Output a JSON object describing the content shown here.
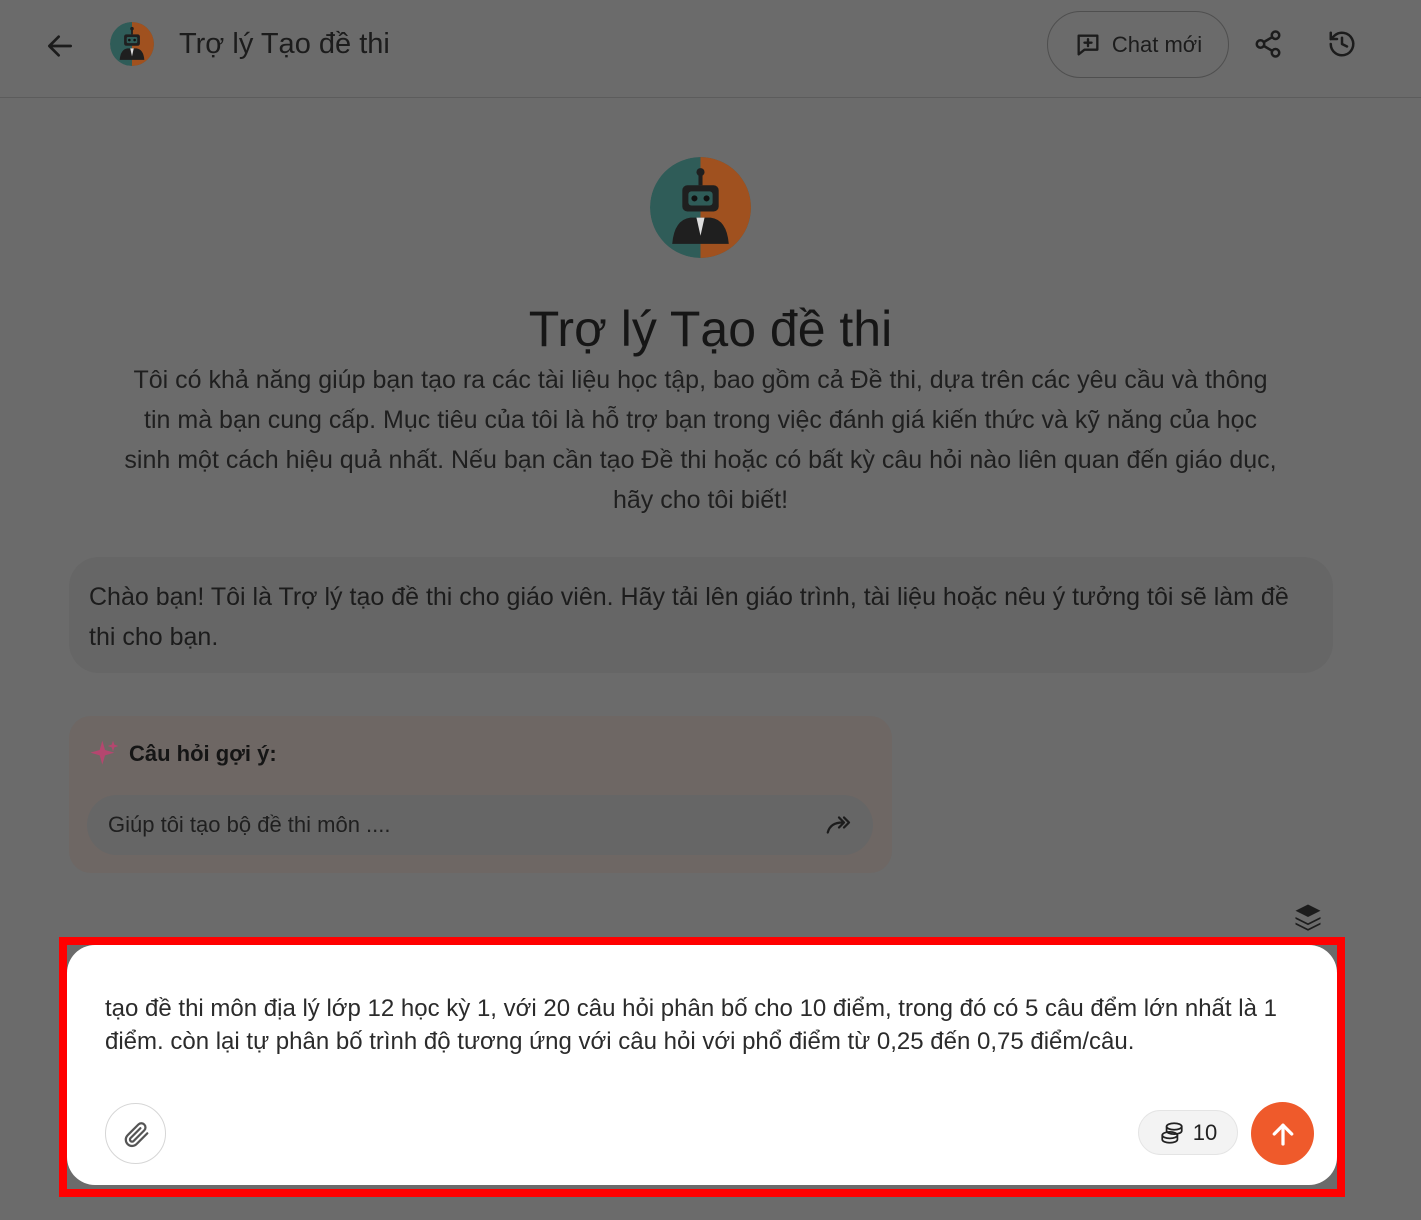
{
  "header": {
    "title": "Trợ lý Tạo đề thi",
    "new_chat_label": "Chat mới"
  },
  "bot": {
    "name": "Trợ lý Tạo đề thi",
    "description": "Tôi có khả năng giúp bạn tạo ra các tài liệu học tập, bao gồm cả Đề thi, dựa trên các yêu cầu và thông tin mà bạn cung cấp. Mục tiêu của tôi là hỗ trợ bạn trong việc đánh giá kiến thức và kỹ năng của học sinh một cách hiệu quả nhất. Nếu bạn cần tạo Đề thi hoặc có bất kỳ câu hỏi nào liên quan đến giáo dục, hãy cho tôi biết!"
  },
  "greeting": "Chào bạn! Tôi là Trợ lý tạo đề thi cho giáo viên. Hãy tải lên giáo trình, tài liệu hoặc nêu ý tưởng tôi sẽ làm đề thi cho bạn.",
  "suggestions": {
    "heading": "Câu hỏi gợi ý:",
    "items": [
      "Giúp tôi tạo bộ đề thi môn ...."
    ]
  },
  "composer": {
    "value": "tạo đề thi môn địa lý lớp 12 học kỳ 1, với 20 câu hỏi phân bố cho 10 điểm, trong đó có 5 câu đểm lớn nhất là 1 điểm. còn lại tự phân bố trình độ tương ứng với câu hỏi với phổ điểm từ 0,25 đến 0,75 điểm/câu.",
    "credits": "10"
  },
  "colors": {
    "accent": "#ef5a2b",
    "highlight_frame": "#ff0000",
    "overlay": "#6b6b6b"
  },
  "icons": [
    "back-arrow-icon",
    "robot-avatar-icon",
    "chat-plus-icon",
    "share-icon",
    "history-icon",
    "sparkle-icon",
    "forward-arrow-icon",
    "layers-icon",
    "paperclip-icon",
    "coins-icon",
    "arrow-up-icon"
  ]
}
